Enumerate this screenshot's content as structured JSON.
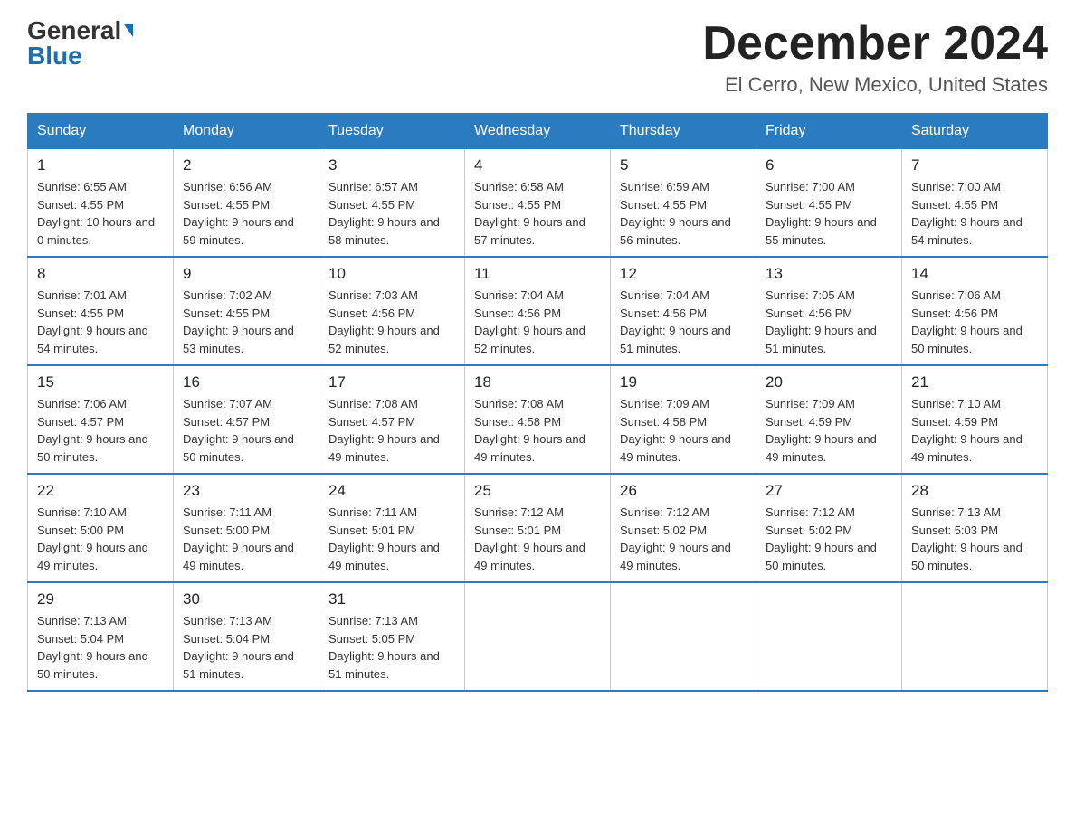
{
  "header": {
    "logo_general": "General",
    "logo_blue": "Blue",
    "month_title": "December 2024",
    "location": "El Cerro, New Mexico, United States"
  },
  "weekdays": [
    "Sunday",
    "Monday",
    "Tuesday",
    "Wednesday",
    "Thursday",
    "Friday",
    "Saturday"
  ],
  "weeks": [
    [
      {
        "day": "1",
        "sunrise": "6:55 AM",
        "sunset": "4:55 PM",
        "daylight": "10 hours and 0 minutes."
      },
      {
        "day": "2",
        "sunrise": "6:56 AM",
        "sunset": "4:55 PM",
        "daylight": "9 hours and 59 minutes."
      },
      {
        "day": "3",
        "sunrise": "6:57 AM",
        "sunset": "4:55 PM",
        "daylight": "9 hours and 58 minutes."
      },
      {
        "day": "4",
        "sunrise": "6:58 AM",
        "sunset": "4:55 PM",
        "daylight": "9 hours and 57 minutes."
      },
      {
        "day": "5",
        "sunrise": "6:59 AM",
        "sunset": "4:55 PM",
        "daylight": "9 hours and 56 minutes."
      },
      {
        "day": "6",
        "sunrise": "7:00 AM",
        "sunset": "4:55 PM",
        "daylight": "9 hours and 55 minutes."
      },
      {
        "day": "7",
        "sunrise": "7:00 AM",
        "sunset": "4:55 PM",
        "daylight": "9 hours and 54 minutes."
      }
    ],
    [
      {
        "day": "8",
        "sunrise": "7:01 AM",
        "sunset": "4:55 PM",
        "daylight": "9 hours and 54 minutes."
      },
      {
        "day": "9",
        "sunrise": "7:02 AM",
        "sunset": "4:55 PM",
        "daylight": "9 hours and 53 minutes."
      },
      {
        "day": "10",
        "sunrise": "7:03 AM",
        "sunset": "4:56 PM",
        "daylight": "9 hours and 52 minutes."
      },
      {
        "day": "11",
        "sunrise": "7:04 AM",
        "sunset": "4:56 PM",
        "daylight": "9 hours and 52 minutes."
      },
      {
        "day": "12",
        "sunrise": "7:04 AM",
        "sunset": "4:56 PM",
        "daylight": "9 hours and 51 minutes."
      },
      {
        "day": "13",
        "sunrise": "7:05 AM",
        "sunset": "4:56 PM",
        "daylight": "9 hours and 51 minutes."
      },
      {
        "day": "14",
        "sunrise": "7:06 AM",
        "sunset": "4:56 PM",
        "daylight": "9 hours and 50 minutes."
      }
    ],
    [
      {
        "day": "15",
        "sunrise": "7:06 AM",
        "sunset": "4:57 PM",
        "daylight": "9 hours and 50 minutes."
      },
      {
        "day": "16",
        "sunrise": "7:07 AM",
        "sunset": "4:57 PM",
        "daylight": "9 hours and 50 minutes."
      },
      {
        "day": "17",
        "sunrise": "7:08 AM",
        "sunset": "4:57 PM",
        "daylight": "9 hours and 49 minutes."
      },
      {
        "day": "18",
        "sunrise": "7:08 AM",
        "sunset": "4:58 PM",
        "daylight": "9 hours and 49 minutes."
      },
      {
        "day": "19",
        "sunrise": "7:09 AM",
        "sunset": "4:58 PM",
        "daylight": "9 hours and 49 minutes."
      },
      {
        "day": "20",
        "sunrise": "7:09 AM",
        "sunset": "4:59 PM",
        "daylight": "9 hours and 49 minutes."
      },
      {
        "day": "21",
        "sunrise": "7:10 AM",
        "sunset": "4:59 PM",
        "daylight": "9 hours and 49 minutes."
      }
    ],
    [
      {
        "day": "22",
        "sunrise": "7:10 AM",
        "sunset": "5:00 PM",
        "daylight": "9 hours and 49 minutes."
      },
      {
        "day": "23",
        "sunrise": "7:11 AM",
        "sunset": "5:00 PM",
        "daylight": "9 hours and 49 minutes."
      },
      {
        "day": "24",
        "sunrise": "7:11 AM",
        "sunset": "5:01 PM",
        "daylight": "9 hours and 49 minutes."
      },
      {
        "day": "25",
        "sunrise": "7:12 AM",
        "sunset": "5:01 PM",
        "daylight": "9 hours and 49 minutes."
      },
      {
        "day": "26",
        "sunrise": "7:12 AM",
        "sunset": "5:02 PM",
        "daylight": "9 hours and 49 minutes."
      },
      {
        "day": "27",
        "sunrise": "7:12 AM",
        "sunset": "5:02 PM",
        "daylight": "9 hours and 50 minutes."
      },
      {
        "day": "28",
        "sunrise": "7:13 AM",
        "sunset": "5:03 PM",
        "daylight": "9 hours and 50 minutes."
      }
    ],
    [
      {
        "day": "29",
        "sunrise": "7:13 AM",
        "sunset": "5:04 PM",
        "daylight": "9 hours and 50 minutes."
      },
      {
        "day": "30",
        "sunrise": "7:13 AM",
        "sunset": "5:04 PM",
        "daylight": "9 hours and 51 minutes."
      },
      {
        "day": "31",
        "sunrise": "7:13 AM",
        "sunset": "5:05 PM",
        "daylight": "9 hours and 51 minutes."
      },
      null,
      null,
      null,
      null
    ]
  ]
}
